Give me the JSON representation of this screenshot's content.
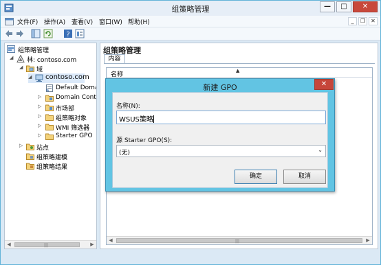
{
  "window": {
    "title": "组策略管理",
    "controls": {
      "minimize": "—",
      "maximize": "□",
      "close": "✕"
    }
  },
  "menubar": {
    "items": [
      "文件(F)",
      "操作(A)",
      "查看(V)",
      "窗口(W)",
      "帮助(H)"
    ],
    "mdi": {
      "minimize": "_",
      "restore": "❐",
      "close": "✕"
    }
  },
  "tree": {
    "items": [
      {
        "label": "组策略管理",
        "icon": "gpm-icon"
      },
      {
        "label": "林: contoso.com",
        "icon": "forest-icon"
      },
      {
        "label": "域",
        "icon": "domains-folder-icon"
      },
      {
        "label": "contoso.com",
        "icon": "domain-icon"
      },
      {
        "label": "Default Domain Policy",
        "icon": "gpo-link-icon"
      },
      {
        "label": "Domain Controllers",
        "icon": "ou-icon"
      },
      {
        "label": "市场部",
        "icon": "ou-icon"
      },
      {
        "label": "组策略对象",
        "icon": "folder-icon"
      },
      {
        "label": "WMI 筛选器",
        "icon": "folder-icon"
      },
      {
        "label": "Starter GPO",
        "icon": "folder-icon"
      },
      {
        "label": "站点",
        "icon": "sites-icon"
      },
      {
        "label": "组策略建模",
        "icon": "modeling-icon"
      },
      {
        "label": "组策略结果",
        "icon": "results-icon"
      }
    ]
  },
  "right": {
    "title": "组策略管理",
    "tab": "内容",
    "column": "名称"
  },
  "dialog": {
    "title": "新建 GPO",
    "close": "✕",
    "name_label": "名称(N):",
    "name_value": "WSUS策略",
    "starter_label": "源 Starter GPO(S):",
    "starter_value": "(无)",
    "ok": "确定",
    "cancel": "取消"
  },
  "colors": {
    "titlebar": "#e6eef7",
    "window_border": "#62b3d8",
    "dialog_frame": "#62c4e3",
    "close_red": "#c6463a"
  }
}
